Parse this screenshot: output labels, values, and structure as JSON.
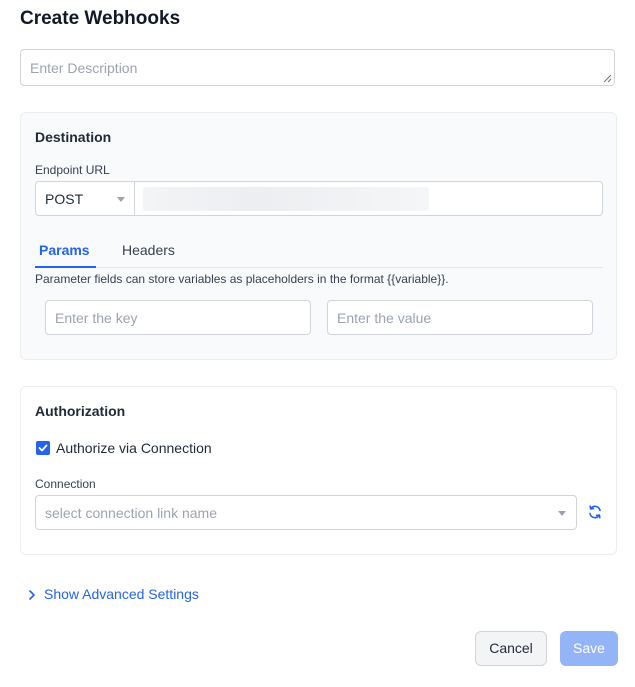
{
  "dialog": {
    "title": "Create Webhooks"
  },
  "description": {
    "placeholder": "Enter Description"
  },
  "destination": {
    "heading": "Destination",
    "endpoint_label": "Endpoint URL",
    "method": "POST",
    "tabs": [
      {
        "label": "Params",
        "active": true
      },
      {
        "label": "Headers",
        "active": false
      }
    ],
    "hint": "Parameter fields can store variables as placeholders in the format {{variable}}.",
    "key_placeholder": "Enter the key",
    "value_placeholder": "Enter the value"
  },
  "authorization": {
    "heading": "Authorization",
    "checkbox_label": "Authorize via Connection",
    "checkbox_checked": true,
    "connection_label": "Connection",
    "connection_placeholder": "select connection link name"
  },
  "advanced": {
    "label": "Show Advanced Settings",
    "icon": "chevron-right-icon"
  },
  "footer": {
    "cancel_label": "Cancel",
    "save_label": "Save"
  },
  "colors": {
    "accent": "#2563eb",
    "save_disabled": "#93b4f7",
    "panel_bg": "#f8fafc"
  }
}
